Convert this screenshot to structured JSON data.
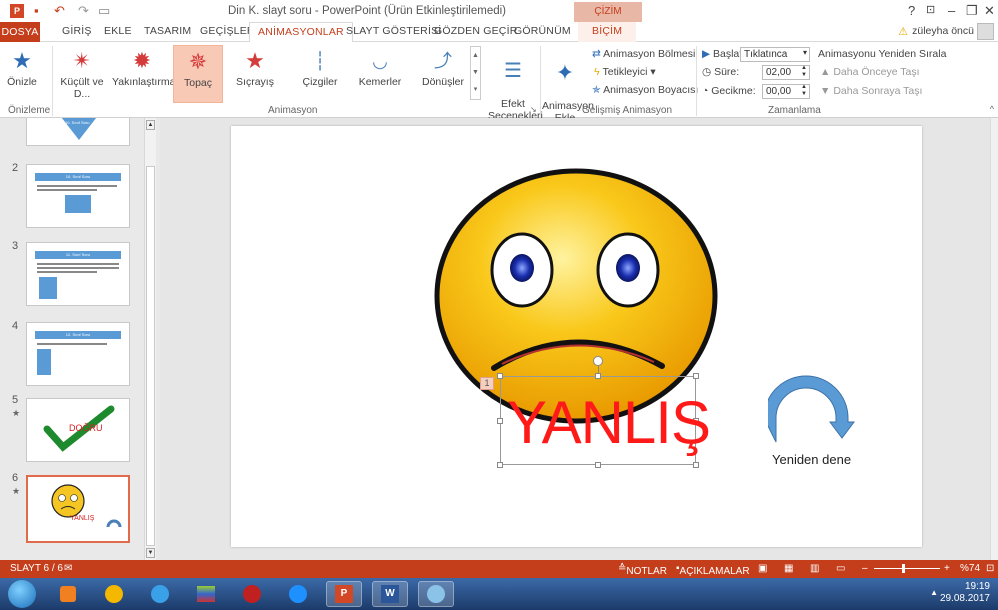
{
  "titlebar": {
    "app_icon": "P",
    "title": "Din K. slayt soru -  PowerPoint (Ürün Etkinleştirilemedi)",
    "context_tab_group": "ÇİZİM ARAÇLARI",
    "help": "?",
    "minimize": "–",
    "restore": "❐",
    "close": "✕"
  },
  "tabs": {
    "file": "DOSYA",
    "items": [
      "GİRİŞ",
      "EKLE",
      "TASARIM",
      "GEÇİŞLER",
      "ANİMASYONLAR",
      "SLAYT GÖSTERİSİ",
      "GÖZDEN GEÇİR",
      "GÖRÜNÜM",
      "BİÇİM"
    ],
    "active": "ANİMASYONLAR",
    "user_name": "züleyha öncü"
  },
  "ribbon": {
    "preview": {
      "label": "Önizle",
      "group": "Önizleme"
    },
    "animation_group": "Animasyon",
    "animations": [
      {
        "label": "Küçült ve D...",
        "icon": "star-shrink-icon"
      },
      {
        "label": "Yakınlaştırma",
        "icon": "star-zoom-icon"
      },
      {
        "label": "Topaç",
        "icon": "star-spin-icon",
        "selected": true
      },
      {
        "label": "Sıçrayış",
        "icon": "star-bounce-icon"
      },
      {
        "label": "Çizgiler",
        "icon": "lines-path-icon"
      },
      {
        "label": "Kemerler",
        "icon": "arcs-path-icon"
      },
      {
        "label": "Dönüşler",
        "icon": "turns-path-icon"
      }
    ],
    "effect_options": "Efekt\nSeçenekleri",
    "advanced": {
      "group": "Gelişmiş Animasyon",
      "add_animation": "Animasyon\nEkle",
      "animation_pane": "Animasyon Bölmesi",
      "trigger": "Tetikleyici",
      "painter": "Animasyon Boyacısı"
    },
    "timing": {
      "group": "Zamanlama",
      "start_label": "Başlat:",
      "start_value": "Tıklatınca",
      "duration_label": "Süre:",
      "duration_value": "02,00",
      "delay_label": "Gecikme:",
      "delay_value": "00,00",
      "reorder_title": "Animasyonu Yeniden Sırala",
      "move_earlier": "Daha Önceye Taşı",
      "move_later": "Daha Sonraya Taşı"
    }
  },
  "slides": [
    {
      "num": "",
      "title": "10. Sınıf Soru"
    },
    {
      "num": "2",
      "title": "10. Sınıf Soru"
    },
    {
      "num": "3",
      "title": "11. Sınıf Soru"
    },
    {
      "num": "4",
      "title": "12. Sınıf Soru"
    },
    {
      "num": "5",
      "text": "DOĞRU",
      "star": "★"
    },
    {
      "num": "6",
      "text": "YANLIŞ",
      "star": "★",
      "selected": true
    }
  ],
  "slide": {
    "wrong_text": "YANLIŞ",
    "anim_order": "1",
    "retry_text": "Yeniden dene"
  },
  "status": {
    "slide_info": "SLAYT 6 / 6",
    "notes": "NOTLAR",
    "comments": "AÇIKLAMALAR",
    "zoom": "%74"
  },
  "taskbar": {
    "time": "19:19",
    "date": "29.08.2017"
  },
  "colors": {
    "accent": "#c43e1c",
    "selected_gallery": "#f8c9b5",
    "wrong_text": "#ff1a1a",
    "arrow": "#4a7fb8"
  }
}
